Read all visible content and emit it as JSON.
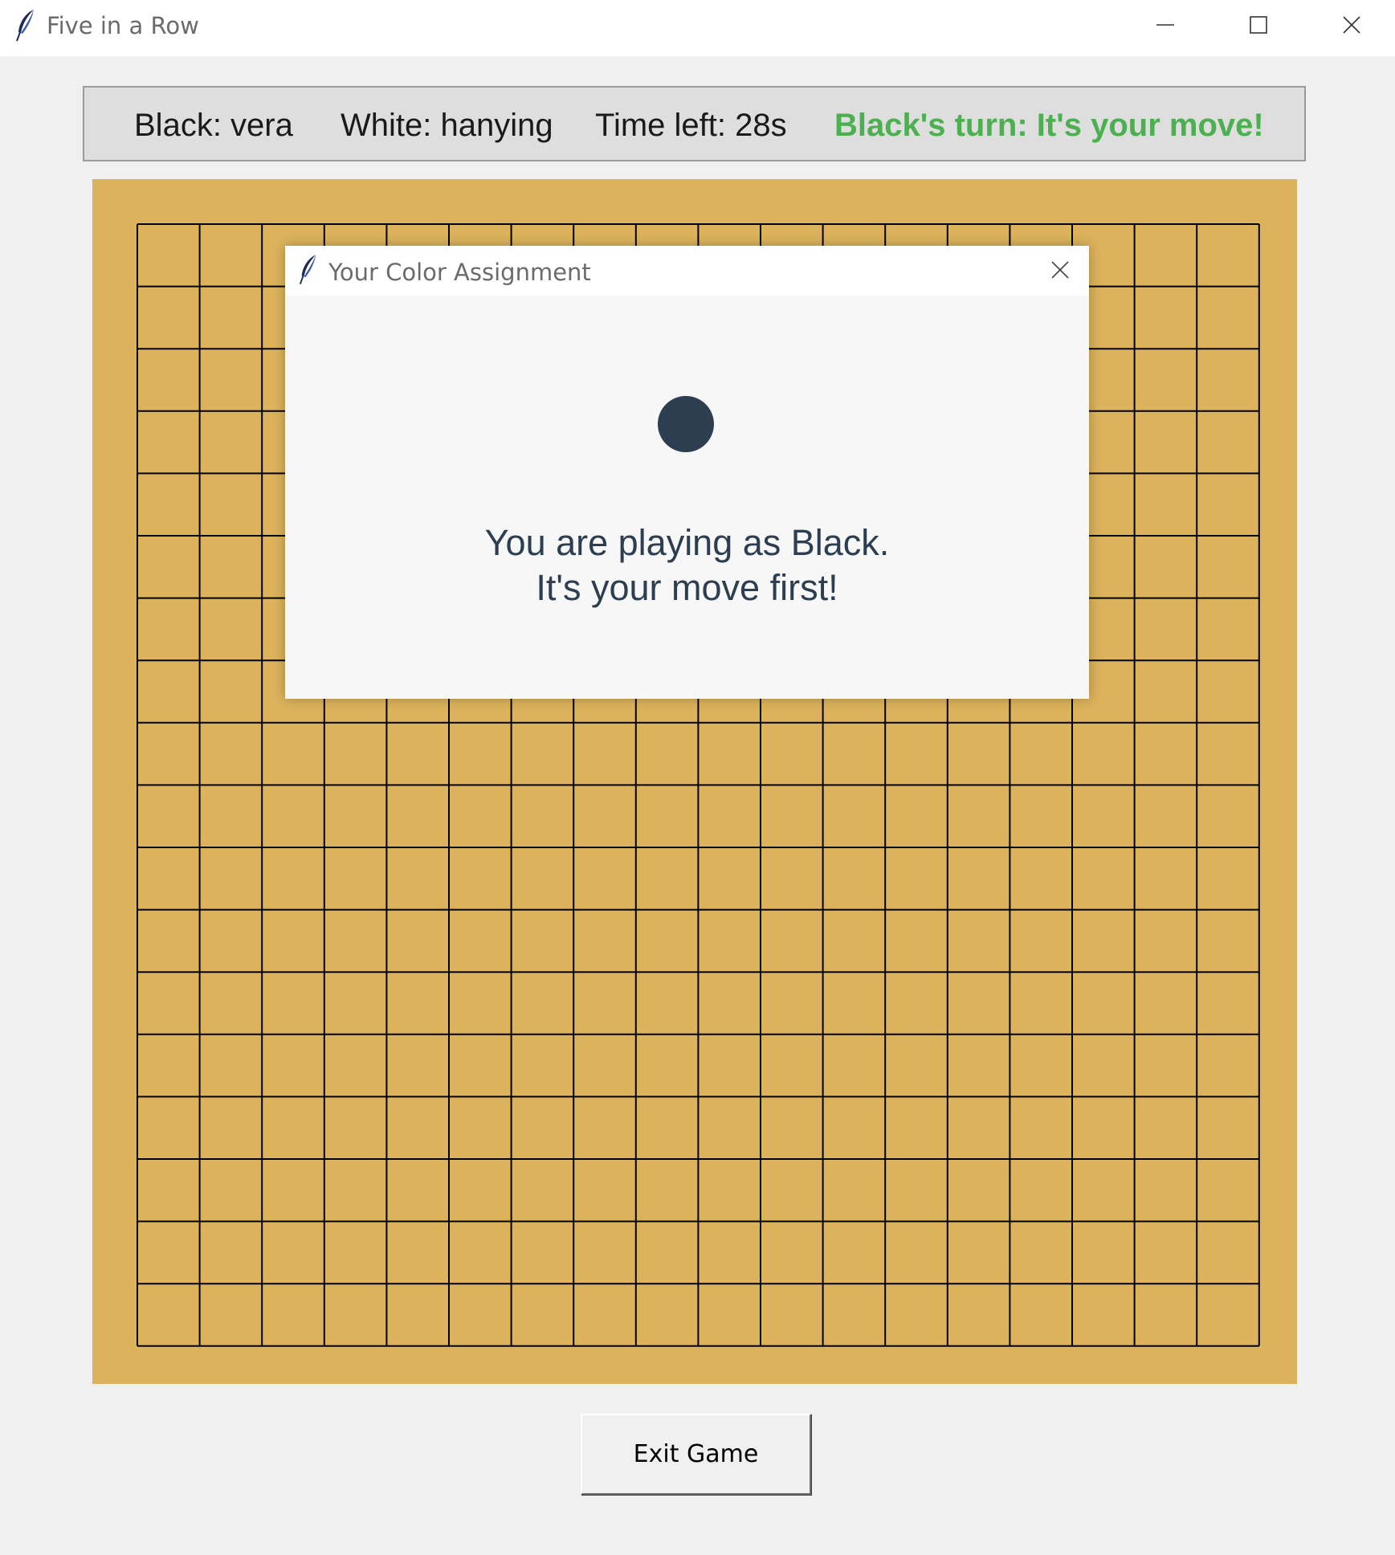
{
  "window": {
    "title": "Five in a Row",
    "icon": "feather-icon",
    "controls": [
      "minimize-icon",
      "maximize-icon",
      "close-icon"
    ]
  },
  "status": {
    "black_player": "Black: vera",
    "white_player": "White: hanying",
    "time_left": "Time left: 28s",
    "turn_message": "Black's turn: It's your move!",
    "turn_color": "#4caf50"
  },
  "board": {
    "size": 19,
    "background_color": "#dcb35c",
    "line_color": "#000000",
    "stones": []
  },
  "dialog": {
    "title": "Your Color Assignment",
    "icon": "feather-icon",
    "stone_color": "#2c3e50",
    "message_line1": "You are playing as Black.",
    "message_line2": "It's your move first!"
  },
  "footer": {
    "exit_label": "Exit Game"
  }
}
